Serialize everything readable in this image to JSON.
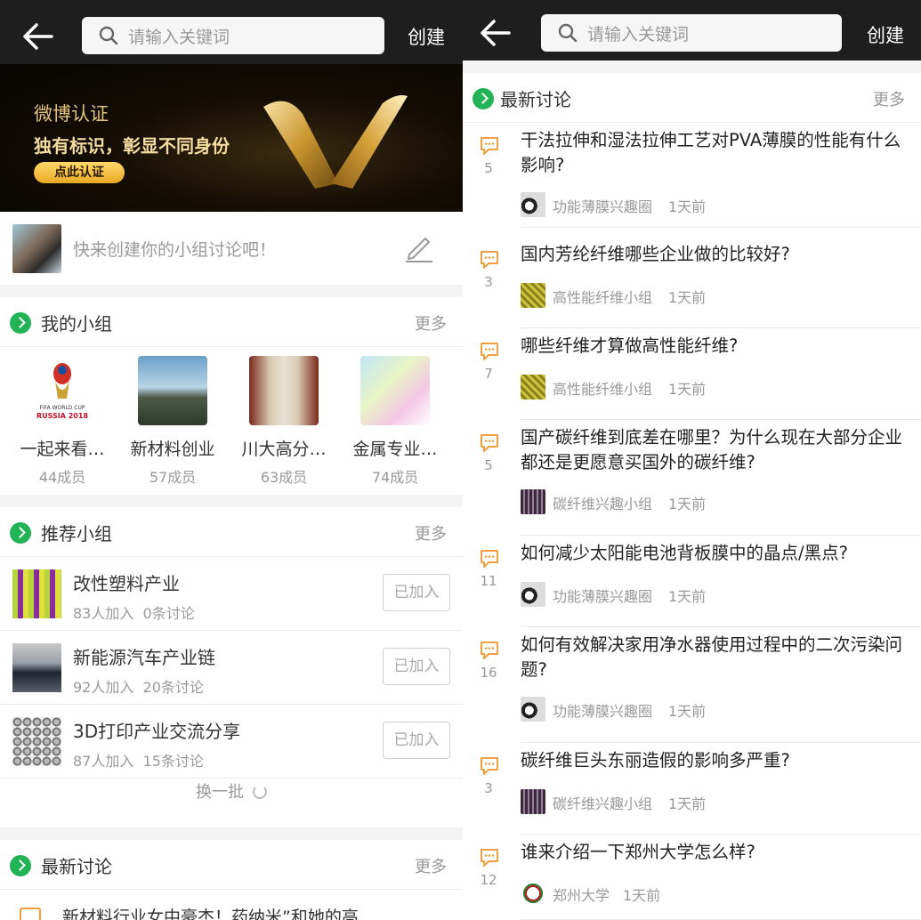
{
  "left": {
    "header": {
      "search_placeholder": "请输入关键词",
      "create_label": "创建"
    },
    "banner": {
      "line1": "微博认证",
      "line2": "独有标识，彰显不同身份",
      "button": "点此认证"
    },
    "compose": {
      "prompt": "快来创建你的小组讨论吧！"
    },
    "my_groups": {
      "title": "我的小组",
      "more": "更多",
      "items": [
        {
          "name": "一起来看…",
          "members": "44成员",
          "badge": "FIFA WORLD CUP RUSSIA 2018"
        },
        {
          "name": "新材料创业",
          "members": "57成员"
        },
        {
          "name": "川大高分…",
          "members": "63成员"
        },
        {
          "name": "金属专业…",
          "members": "74成员"
        }
      ]
    },
    "recommended": {
      "title": "推荐小组",
      "more": "更多",
      "items": [
        {
          "name": "改性塑料产业",
          "joined": "83人加入",
          "topics": "0条讨论",
          "button": "已加入"
        },
        {
          "name": "新能源汽车产业链",
          "joined": "92人加入",
          "topics": "20条讨论",
          "button": "已加入"
        },
        {
          "name": "3D打印产业交流分享",
          "joined": "87人加入",
          "topics": "15条讨论",
          "button": "已加入"
        }
      ],
      "refresh": "换一批"
    },
    "latest": {
      "title": "最新讨论",
      "more": "更多",
      "peek": "新材料行业女中豪杰！药纳米”和她的高"
    }
  },
  "right": {
    "header": {
      "search_placeholder": "请输入关键词",
      "create_label": "创建"
    },
    "latest": {
      "title": "最新讨论",
      "more": "更多",
      "items": [
        {
          "count": "5",
          "question": "干法拉伸和湿法拉伸工艺对PVA薄膜的性能有什么影响?",
          "group": "功能薄膜兴趣圈",
          "time": "1天前",
          "thumb": "film"
        },
        {
          "count": "3",
          "question": "国内芳纶纤维哪些企业做的比较好?",
          "group": "高性能纤维小组",
          "time": "1天前",
          "thumb": "fiber"
        },
        {
          "count": "7",
          "question": "哪些纤维才算做高性能纤维?",
          "group": "高性能纤维小组",
          "time": "1天前",
          "thumb": "fiber"
        },
        {
          "count": "5",
          "question": "国产碳纤维到底差在哪里？为什么现在大部分企业都还是更愿意买国外的碳纤维?",
          "group": "碳纤维兴趣小组",
          "time": "1天前",
          "thumb": "carbon"
        },
        {
          "count": "11",
          "question": "如何减少太阳能电池背板膜中的晶点/黑点?",
          "group": "功能薄膜兴趣圈",
          "time": "1天前",
          "thumb": "film"
        },
        {
          "count": "16",
          "question": "如何有效解决家用净水器使用过程中的二次污染问题?",
          "group": "功能薄膜兴趣圈",
          "time": "1天前",
          "thumb": "film"
        },
        {
          "count": "3",
          "question": "碳纤维巨头东丽造假的影响多严重?",
          "group": "碳纤维兴趣小组",
          "time": "1天前",
          "thumb": "carbon"
        },
        {
          "count": "12",
          "question": "谁来介绍一下郑州大学怎么样?",
          "group": "郑州大学",
          "time": "1天前",
          "thumb": "zzu"
        }
      ]
    }
  },
  "colors": {
    "accent_green": "#23b357",
    "comment_orange": "#f0a040",
    "topbar": "#1e1e1e",
    "banner_gold": "#e0c27a"
  }
}
